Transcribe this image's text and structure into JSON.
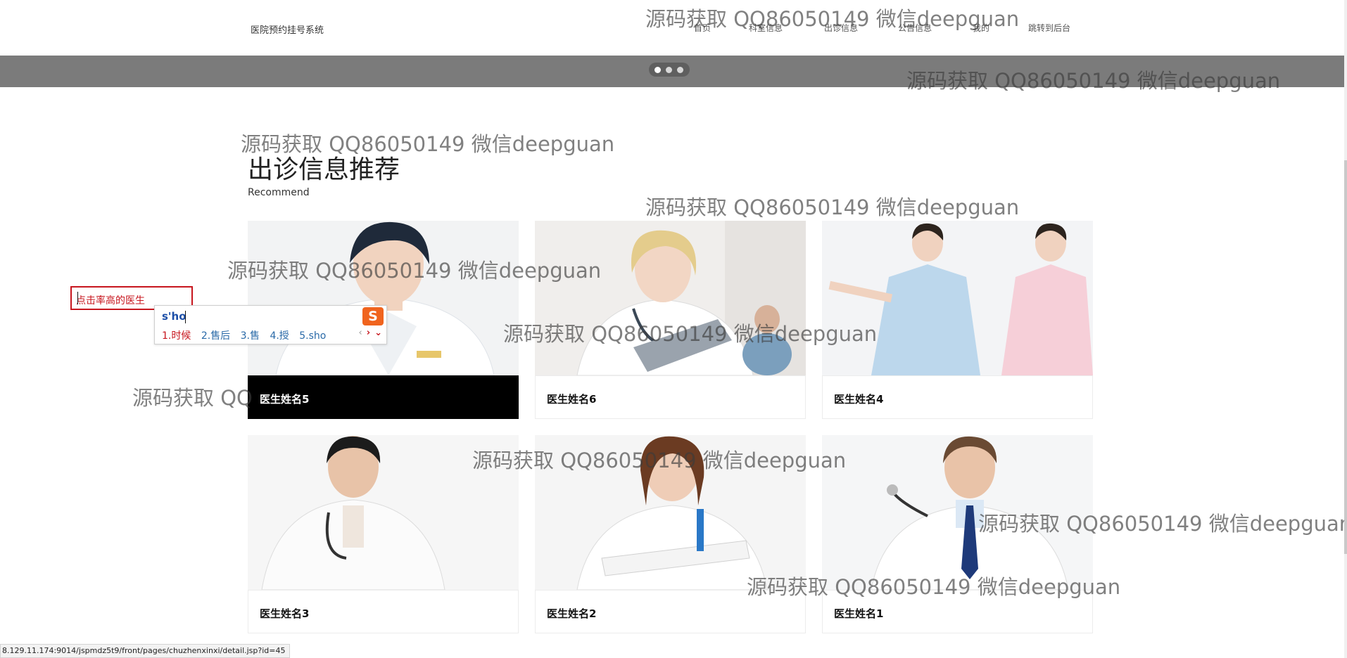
{
  "header": {
    "site_title": "医院预约挂号系统",
    "nav": [
      "首页",
      "科室信息",
      "出诊信息",
      "公告信息",
      "我的",
      "跳转到后台"
    ]
  },
  "banner": {
    "slide_count": 3,
    "active_slide": 1
  },
  "section": {
    "title": "出诊信息推荐",
    "subtitle": "Recommend"
  },
  "cards": [
    {
      "name": "医生姓名5",
      "active": true
    },
    {
      "name": "医生姓名6",
      "active": false
    },
    {
      "name": "医生姓名4",
      "active": false
    },
    {
      "name": "医生姓名3",
      "active": false
    },
    {
      "name": "医生姓名2",
      "active": false
    },
    {
      "name": "医生姓名1",
      "active": false
    }
  ],
  "floating_search": {
    "text": "点击率高的医生"
  },
  "ime": {
    "composition": "s'ho",
    "candidates": [
      "1.时候",
      "2.售后",
      "3.售",
      "4.授",
      "5.sho"
    ],
    "logo": "S"
  },
  "watermark": {
    "text": "源码获取 QQ86050149 微信deepguan",
    "partial": "源码获取 QQ",
    "cut_right": "源码获取 QQ86050149 微信deepguar"
  },
  "status_bar": {
    "url": "8.129.11.174:9014/jspmdz5t9/front/pages/chuzhenxinxi/detail.jsp?id=45"
  },
  "colors": {
    "banner": "#7b7b7b",
    "accent_red": "#c7161e",
    "ime_blue": "#1d4fa8",
    "active_card": "#000000"
  }
}
